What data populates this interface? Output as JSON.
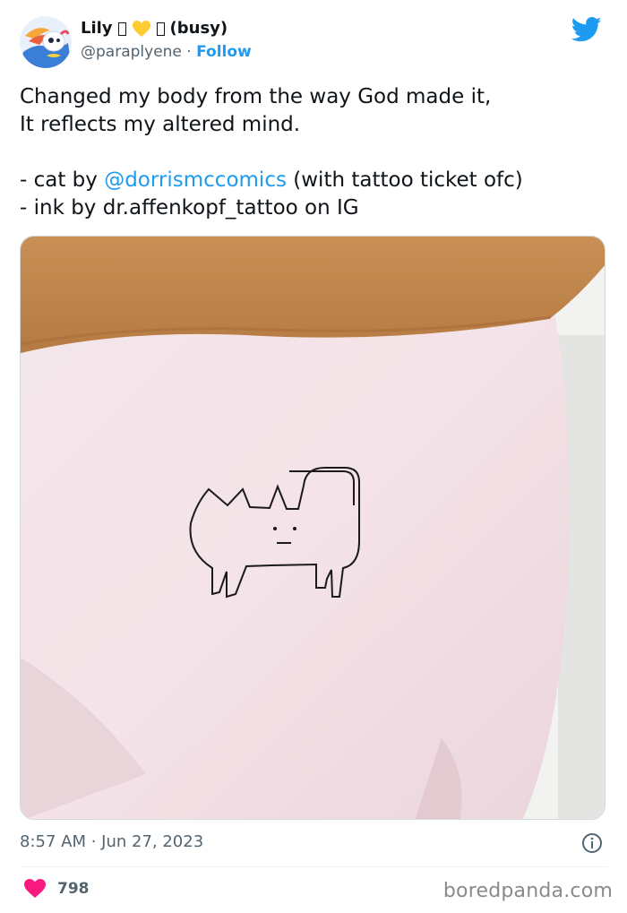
{
  "user": {
    "display_name": "Lily",
    "status": "(busy)",
    "handle": "@paraplyene",
    "separator": "·",
    "follow_label": "Follow"
  },
  "tweet": {
    "line1": "Changed my body from the way God made it,",
    "line2": "It reflects my altered mind.",
    "credit1_prefix": "- cat by ",
    "credit1_mention": "@dorrismccomics",
    "credit1_suffix": " (with tattoo ticket ofc)",
    "credit2": "- ink by dr.affenkopf_tattoo on IG"
  },
  "meta": {
    "timestamp": "8:57 AM · Jun 27, 2023",
    "like_count": "798"
  },
  "watermark": "boredpanda.com",
  "icons": {
    "brand": "twitter-bird-icon",
    "info": "info-icon",
    "like": "heart-icon",
    "emoji": "yellow-heart-icon"
  },
  "colors": {
    "accent": "#1d9bf0",
    "like": "#f91880",
    "muted": "#536471",
    "heart_yellow": "#ffcc33"
  }
}
